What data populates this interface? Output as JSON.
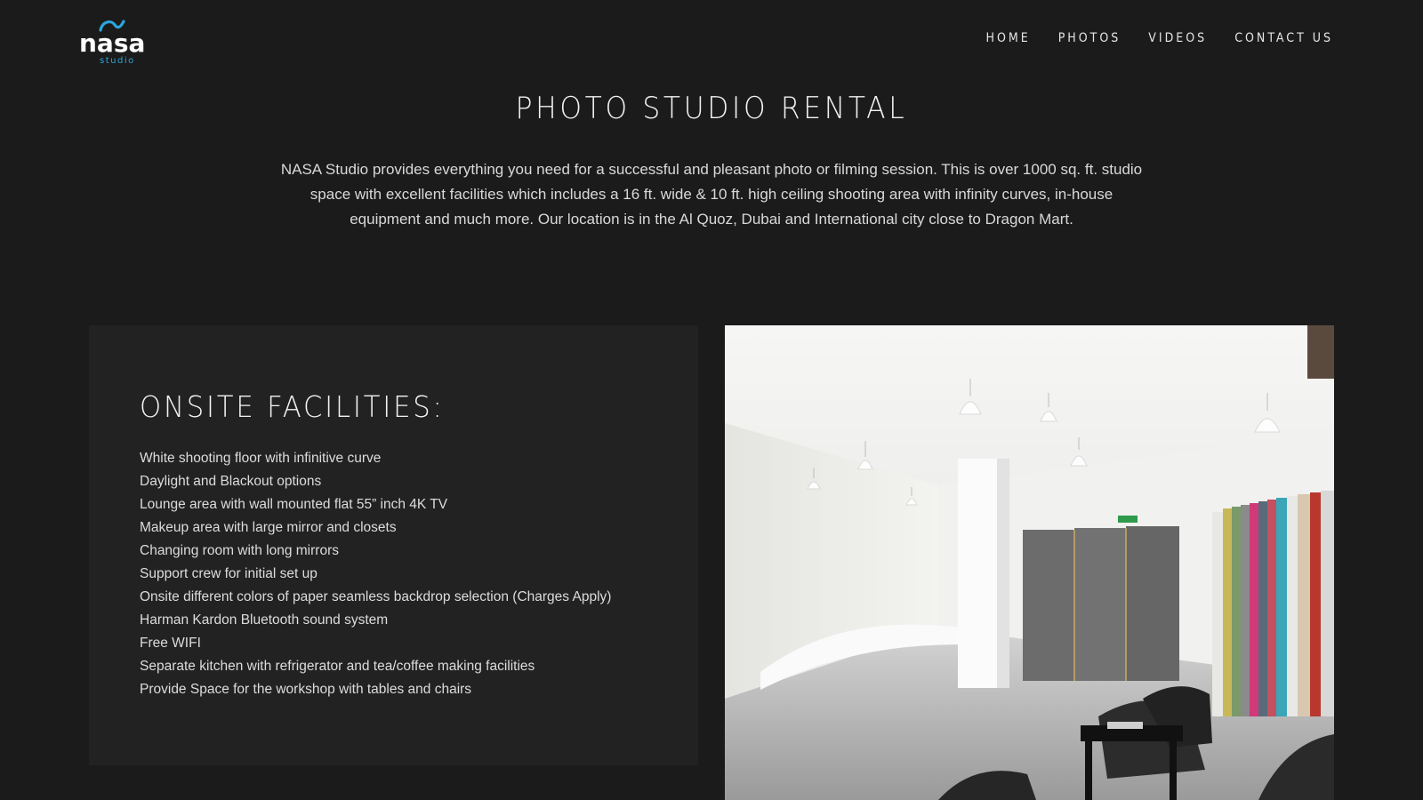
{
  "brand": {
    "logo_text": "nasa",
    "logo_subtext": "studio",
    "accent": "#2aa6df"
  },
  "nav": {
    "items": [
      {
        "label": "HOME"
      },
      {
        "label": "PHOTOS"
      },
      {
        "label": "VIDEOS"
      },
      {
        "label": "CONTACT US"
      }
    ]
  },
  "hero": {
    "title": "PHOTO STUDIO RENTAL",
    "description": "NASA Studio provides everything you need for a successful and pleasant photo or filming session. This is over 1000 sq. ft. studio space with excellent facilities which includes a 16 ft. wide & 10 ft. high ceiling shooting area with infinity curves, in-house equipment and much more. Our location is in the Al Quoz, Dubai and International city close to Dragon Mart."
  },
  "facilities": {
    "title": "ONSITE FACILITIES:",
    "items": [
      "White shooting floor with infinitive curve",
      "Daylight and Blackout options",
      "Lounge area with wall mounted flat 55” inch 4K TV",
      "Makeup area with large mirror and closets",
      "Changing room with long mirrors",
      "Support crew for initial set up",
      "Onsite different colors of paper seamless backdrop selection (Charges Apply)",
      "Harman Kardon Bluetooth sound system",
      "Free WIFI",
      "Separate kitchen with refrigerator and tea/coffee making facilities",
      "Provide Space for the workshop with tables and chairs"
    ]
  },
  "colors": {
    "background": "#1b1b1b",
    "panel": "#222222"
  }
}
